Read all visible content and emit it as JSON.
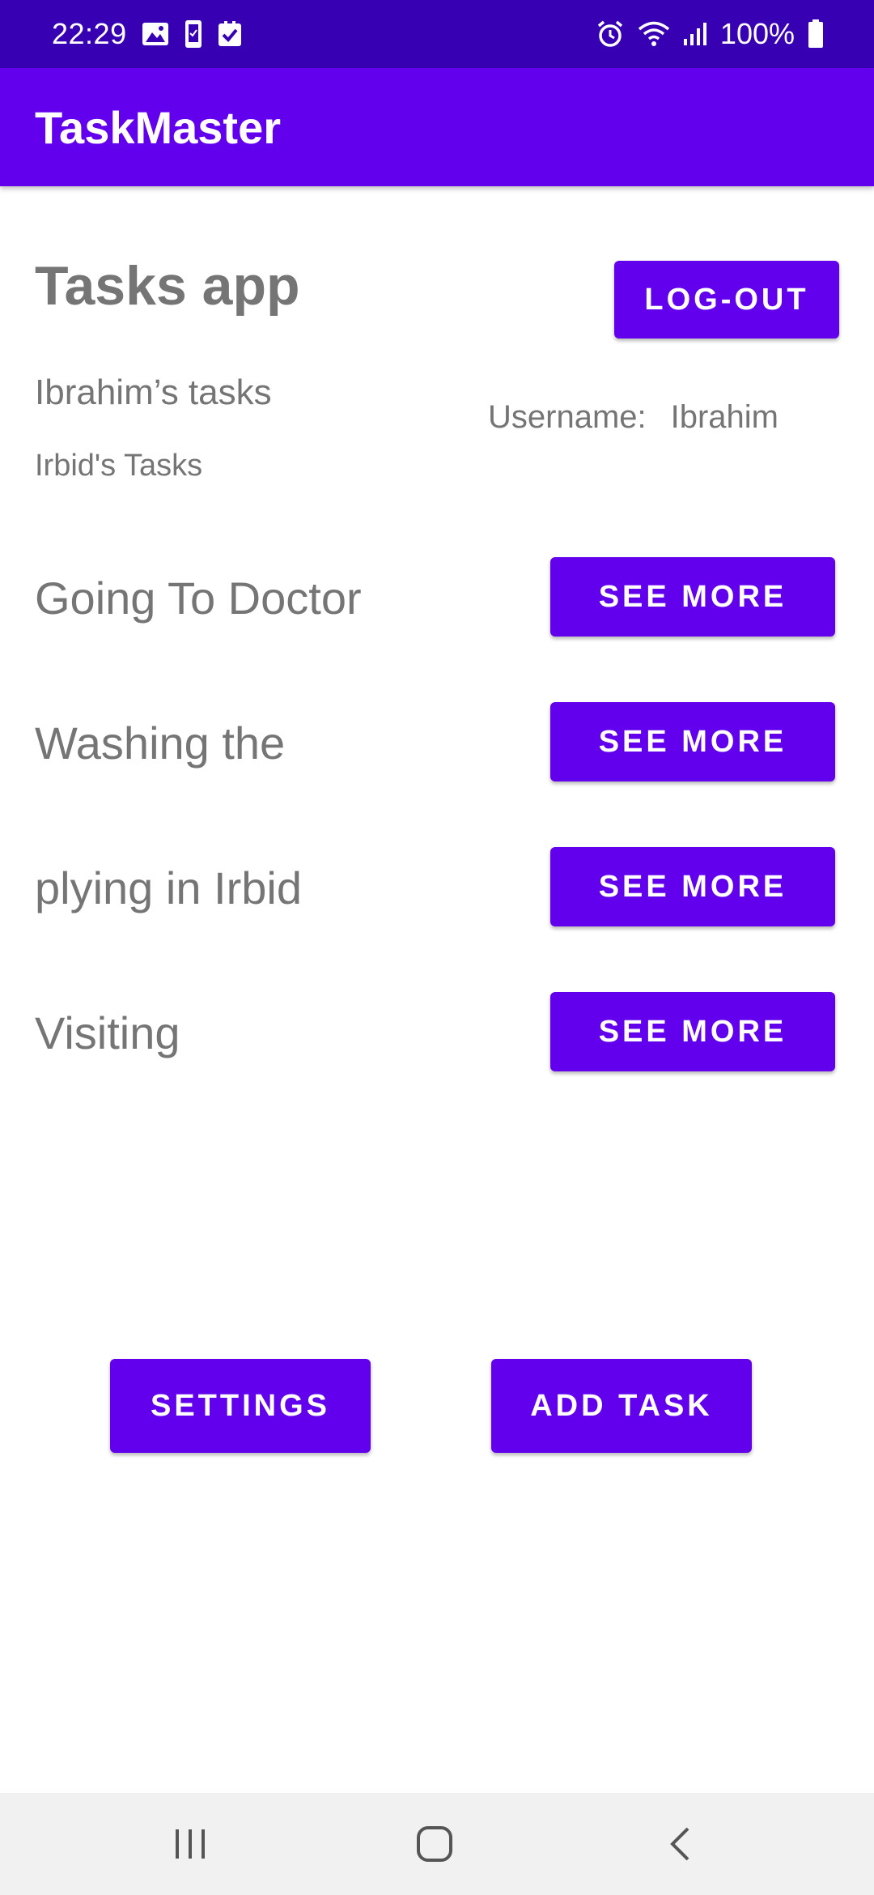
{
  "status_bar": {
    "time": "22:29",
    "battery_text": "100%",
    "left_icons": [
      "image-icon",
      "phone-icon",
      "checkbox-icon"
    ],
    "right_icons": [
      "alarm-icon",
      "wifi-icon",
      "signal-icon",
      "battery-icon"
    ]
  },
  "app_bar": {
    "title": "TaskMaster"
  },
  "header": {
    "title": "Tasks app",
    "logout_label": "LOG-OUT"
  },
  "user": {
    "owner_tasks_label": "Ibrahim’s tasks",
    "team_tasks_label": "Irbid's Tasks",
    "username_label": "Username:",
    "username_value": "Ibrahim"
  },
  "tasks": [
    {
      "title": "Going To Doctor",
      "button_label": "SEE MORE"
    },
    {
      "title": "Washing the",
      "button_label": "SEE MORE"
    },
    {
      "title": "plying in Irbid",
      "button_label": "SEE MORE"
    },
    {
      "title": "Visiting",
      "button_label": "SEE MORE"
    }
  ],
  "footer": {
    "settings_label": "SETTINGS",
    "add_task_label": "ADD TASK"
  },
  "nav_bar": {
    "icons": [
      "recent-apps-icon",
      "home-icon",
      "back-icon"
    ]
  },
  "colors": {
    "primary": "#6200EE",
    "primary_dark": "#3700B3",
    "text_secondary": "#757575",
    "nav_background": "#F1F1F1"
  }
}
